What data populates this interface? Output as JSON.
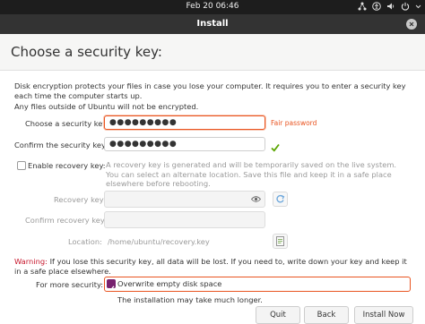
{
  "topbar": {
    "clock": "Feb 20  06:46"
  },
  "window": {
    "title": "Install"
  },
  "page": {
    "heading": "Choose a security key:"
  },
  "intro": {
    "line1": "Disk encryption protects your files in case you lose your computer. It requires you to enter a security key each time the computer starts up.",
    "line2": "Any files outside of Ubuntu will not be encrypted."
  },
  "form": {
    "choose_label": "Choose a security key:",
    "choose_value": "●●●●●●●●●",
    "strength": "Fair password",
    "confirm_label": "Confirm the security key:",
    "confirm_value": "●●●●●●●●●",
    "recovery_checkbox_label": "Enable recovery key:",
    "recovery_description": "A recovery key is generated and will be temporarily saved on the live system. You can select an alternate location. Save this file and keep it in a safe place elsewhere before rebooting.",
    "recovery_key_label": "Recovery key:",
    "confirm_recovery_label": "Confirm recovery key:",
    "location_label": "Location:",
    "location_value": "/home/ubuntu/recovery.key"
  },
  "warning": {
    "prefix": "Warning:",
    "text": "If you lose this security key, all data will be lost. If you need to, write down your key and keep it in a safe place elsewhere."
  },
  "security": {
    "label": "For more security:",
    "option": "Overwrite empty disk space",
    "note": "The installation may take much longer."
  },
  "buttons": {
    "quit": "Quit",
    "back": "Back",
    "install": "Install Now"
  },
  "colors": {
    "accent": "#e95420",
    "success": "#5aa500",
    "checkbox_purple": "#77216f"
  }
}
